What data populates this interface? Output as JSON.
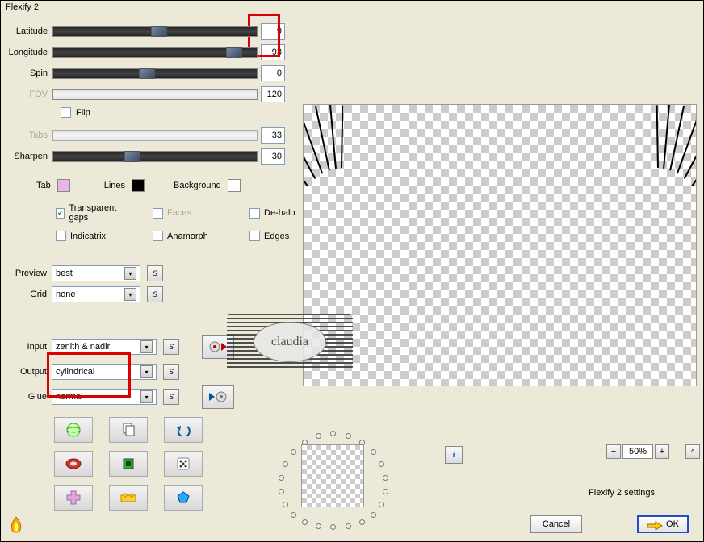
{
  "window": {
    "title": "Flexify 2"
  },
  "sliders": {
    "latitude": {
      "label": "Latitude",
      "value": "9",
      "thumb_pct": 48
    },
    "longitude": {
      "label": "Longitude",
      "value": "93",
      "thumb_pct": 85
    },
    "spin": {
      "label": "Spin",
      "value": "0",
      "thumb_pct": 42
    },
    "fov": {
      "label": "FOV",
      "value": "120",
      "thumb_pct": null
    },
    "tabs": {
      "label": "Tabs",
      "value": "33",
      "thumb_pct": null
    },
    "sharpen": {
      "label": "Sharpen",
      "value": "30",
      "thumb_pct": 35
    }
  },
  "flip": {
    "label": "Flip",
    "checked": false
  },
  "colors": {
    "tab": {
      "label": "Tab",
      "hex": "#e6b8e6"
    },
    "lines": {
      "label": "Lines",
      "hex": "#000000"
    },
    "background": {
      "label": "Background",
      "hex": "#ffffff"
    }
  },
  "checks": {
    "transparent_gaps": {
      "label": "Transparent gaps",
      "checked": true
    },
    "faces": {
      "label": "Faces",
      "checked": false,
      "disabled": true
    },
    "dehalo": {
      "label": "De-halo",
      "checked": false
    },
    "indicatrix": {
      "label": "Indicatrix",
      "checked": false
    },
    "anamorph": {
      "label": "Anamorph",
      "checked": false
    },
    "edges": {
      "label": "Edges",
      "checked": false
    }
  },
  "dropdowns": {
    "preview": {
      "label": "Preview",
      "value": "best"
    },
    "grid": {
      "label": "Grid",
      "value": "none"
    },
    "input": {
      "label": "Input",
      "value": "zenith & nadir"
    },
    "output": {
      "label": "Output",
      "value": "cylindrical"
    },
    "glue": {
      "label": "Glue",
      "value": "normal"
    }
  },
  "zoom": {
    "value": "50%",
    "minus": "−",
    "plus": "+"
  },
  "footer": {
    "settings_label": "Flexify 2 settings",
    "ok": "OK",
    "cancel": "Cancel"
  },
  "watermark": "claudia"
}
